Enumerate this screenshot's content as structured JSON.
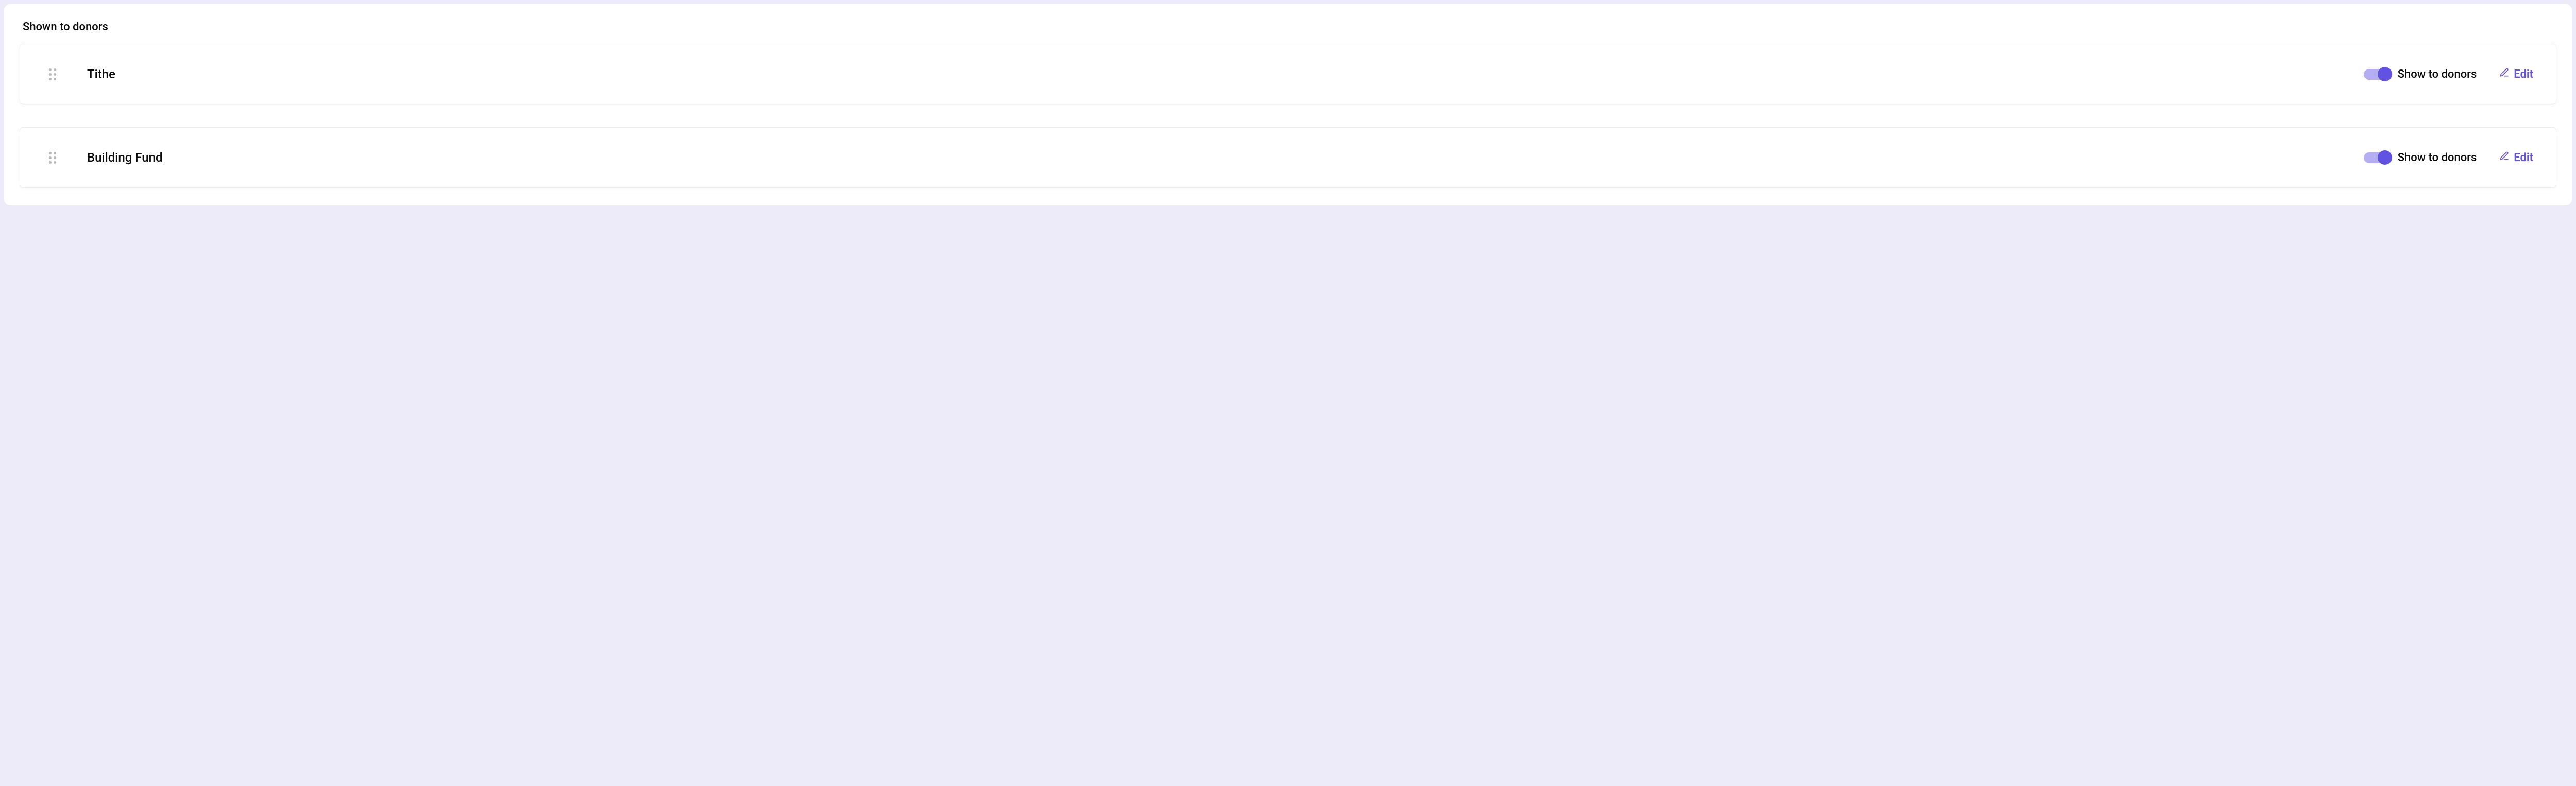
{
  "section": {
    "title": "Shown to donors"
  },
  "funds": [
    {
      "name": "Tithe",
      "toggle_label": "Show to donors",
      "toggle_on": true,
      "edit_label": "Edit"
    },
    {
      "name": "Building Fund",
      "toggle_label": "Show to donors",
      "toggle_on": true,
      "edit_label": "Edit"
    }
  ],
  "colors": {
    "accent": "#6252E2",
    "toggle_track": "#B6AEF2",
    "bg": "#EDEBFA"
  }
}
